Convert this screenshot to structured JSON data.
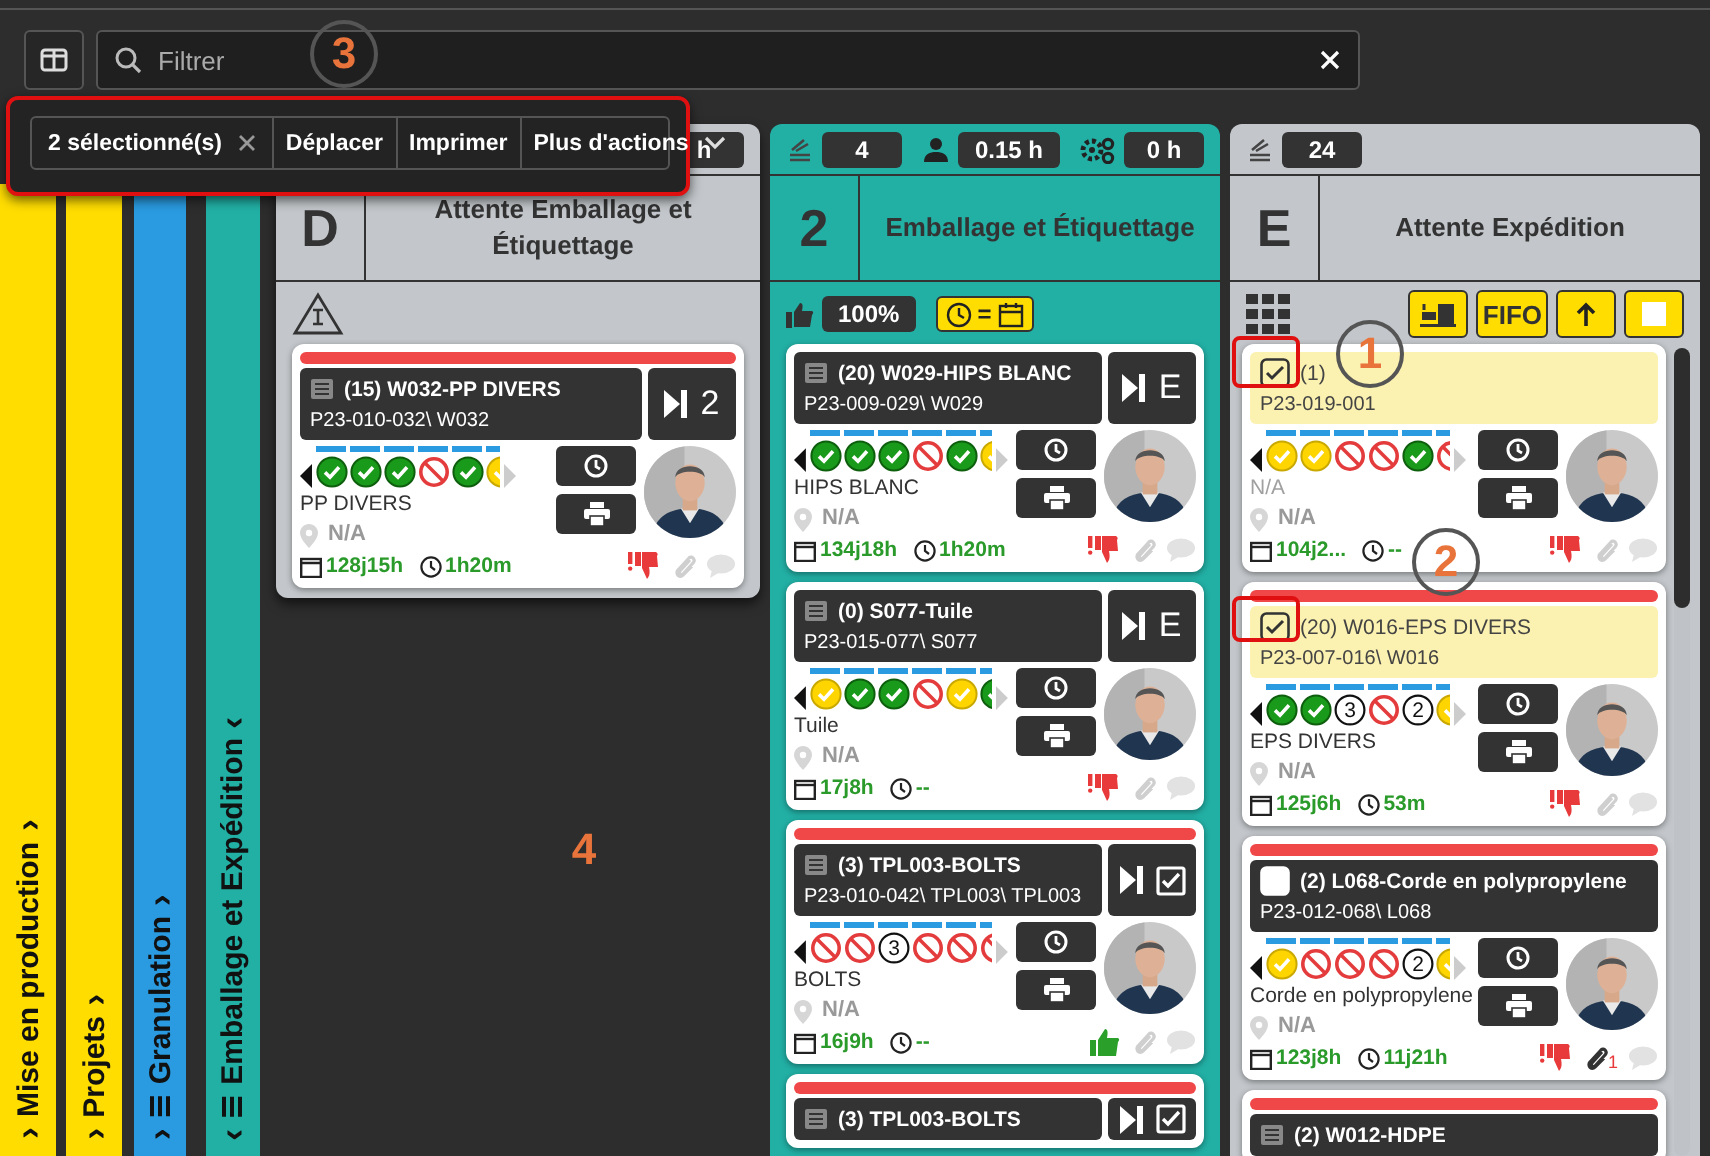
{
  "filter": {
    "placeholder": "Filtrer"
  },
  "selection_bar": {
    "count": "2 sélectionné(s)",
    "actions": [
      "Déplacer",
      "Imprimer"
    ],
    "more": "Plus d'actions"
  },
  "strips": [
    {
      "label": "Mise en production",
      "color": "#ffdd00",
      "lead": "›",
      "trail": "›",
      "menu": false
    },
    {
      "label": "Projets",
      "color": "#ffdd00",
      "lead": "›",
      "trail": "›",
      "menu": false
    },
    {
      "label": "Granulation",
      "color": "#2a9be0",
      "lead": "›",
      "trail": "›",
      "menu": true
    },
    {
      "label": "Emballage et Expédition",
      "color": "#22b0a5",
      "lead": "‹",
      "trail": "‹",
      "menu": true
    }
  ],
  "columns": [
    {
      "letter": "D",
      "title": "Attente Emballage et Étiquettage",
      "color": "#c3c7cb",
      "scrollbar": false,
      "stats": [
        {
          "kind": "plain",
          "value": "h"
        }
      ],
      "tools": [
        {
          "kind": "warning"
        }
      ],
      "cards": [
        {
          "flag": true,
          "kind": "list",
          "title": "(15) W032-PP DIVERS",
          "code": "P23-010-032\\ W032",
          "step": {
            "kind": "text",
            "text": "2"
          },
          "dots": [
            {
              "kind": "ok"
            },
            {
              "kind": "ok"
            },
            {
              "kind": "ok"
            },
            {
              "kind": "no"
            },
            {
              "kind": "ok"
            },
            {
              "kind": "warn"
            }
          ],
          "name": "PP DIVERS",
          "muted": false,
          "location": "N/A",
          "days": "128j15h",
          "time": "1h20m",
          "liked": false
        }
      ]
    },
    {
      "letter": "2",
      "title": "Emballage et Étiquettage",
      "color": "#22b0a5",
      "scrollbar": false,
      "stats": [
        {
          "kind": "stack",
          "value": "4"
        },
        {
          "kind": "person",
          "value": "0.15 h"
        },
        {
          "kind": "gears",
          "value": "0 h"
        }
      ],
      "tools": [
        {
          "kind": "thumb",
          "text": "100%"
        },
        {
          "kind": "equal",
          "text": "="
        }
      ],
      "cards": [
        {
          "flag": false,
          "kind": "list",
          "title": "(20) W029-HIPS BLANC",
          "code": "P23-009-029\\ W029",
          "step": {
            "kind": "text",
            "text": "E"
          },
          "dots": [
            {
              "kind": "ok"
            },
            {
              "kind": "ok"
            },
            {
              "kind": "ok"
            },
            {
              "kind": "no"
            },
            {
              "kind": "ok"
            },
            {
              "kind": "warn"
            }
          ],
          "name": "HIPS BLANC",
          "muted": false,
          "location": "N/A",
          "days": "134j18h",
          "time": "1h20m",
          "liked": false
        },
        {
          "flag": false,
          "kind": "list",
          "title": "(0) S077-Tuile",
          "code": "P23-015-077\\ S077",
          "step": {
            "kind": "text",
            "text": "E"
          },
          "dots": [
            {
              "kind": "warn"
            },
            {
              "kind": "ok"
            },
            {
              "kind": "ok"
            },
            {
              "kind": "no"
            },
            {
              "kind": "warn"
            },
            {
              "kind": "ok"
            }
          ],
          "name": "Tuile",
          "muted": false,
          "location": "N/A",
          "days": "17j8h",
          "time": "--",
          "liked": false
        },
        {
          "flag": true,
          "kind": "list",
          "title": "(3) TPL003-BOLTS",
          "code": "P23-010-042\\ TPL003\\ TPL003",
          "step": {
            "kind": "check"
          },
          "dots": [
            {
              "kind": "no"
            },
            {
              "kind": "no"
            },
            {
              "kind": "num",
              "label": "3"
            },
            {
              "kind": "no"
            },
            {
              "kind": "no"
            },
            {
              "kind": "no"
            }
          ],
          "name": "BOLTS",
          "muted": false,
          "location": "N/A",
          "days": "16j9h",
          "time": "--",
          "liked": true
        },
        {
          "flag": true,
          "kind": "list",
          "title": "(3) TPL003-BOLTS",
          "step": {
            "kind": "check"
          }
        }
      ]
    },
    {
      "letter": "E",
      "title": "Attente Expédition",
      "color": "#c3c7cb",
      "scrollbar": true,
      "stats": [
        {
          "kind": "stack",
          "value": "24"
        }
      ],
      "tools": [
        {
          "kind": "grid"
        },
        {
          "kind": "truck"
        },
        {
          "kind": "text",
          "text": "FIFO"
        },
        {
          "kind": "up"
        },
        {
          "kind": "stop"
        }
      ],
      "cards": [
        {
          "flag": false,
          "kind": "select",
          "checked": true,
          "title": "(1)",
          "code": "P23-019-001",
          "dots": [
            {
              "kind": "warn"
            },
            {
              "kind": "warn"
            },
            {
              "kind": "no"
            },
            {
              "kind": "no"
            },
            {
              "kind": "ok"
            },
            {
              "kind": "no"
            }
          ],
          "name": "N/A",
          "muted": true,
          "location": "N/A",
          "days": "104j2...",
          "time": "--",
          "liked": false
        },
        {
          "flag": true,
          "kind": "select",
          "checked": true,
          "title": "(20) W016-EPS DIVERS",
          "code": "P23-007-016\\ W016",
          "dots": [
            {
              "kind": "ok"
            },
            {
              "kind": "ok"
            },
            {
              "kind": "num",
              "label": "3"
            },
            {
              "kind": "no"
            },
            {
              "kind": "num",
              "label": "2"
            },
            {
              "kind": "warn"
            }
          ],
          "name": "EPS DIVERS",
          "muted": false,
          "location": "N/A",
          "days": "125j6h",
          "time": "53m",
          "liked": false
        },
        {
          "flag": true,
          "kind": "select",
          "checked": false,
          "title": "(2) L068-Corde en polypropylene",
          "code": "P23-012-068\\ L068",
          "dots": [
            {
              "kind": "warn"
            },
            {
              "kind": "no"
            },
            {
              "kind": "no"
            },
            {
              "kind": "no"
            },
            {
              "kind": "num",
              "label": "2"
            },
            {
              "kind": "warn"
            }
          ],
          "name": "Corde en polypropylene",
          "muted": false,
          "location": "N/A",
          "days": "123j8h",
          "time": "11j21h",
          "liked": false,
          "attachments": "1"
        },
        {
          "flag": true,
          "kind": "list",
          "title": "(2) W012-HDPE"
        }
      ]
    }
  ],
  "annotations": [
    {
      "label": "3",
      "kind": "circle"
    },
    {
      "label": "1",
      "kind": "circle"
    },
    {
      "label": "2",
      "kind": "circle"
    },
    {
      "label": "4",
      "kind": "plain"
    }
  ]
}
